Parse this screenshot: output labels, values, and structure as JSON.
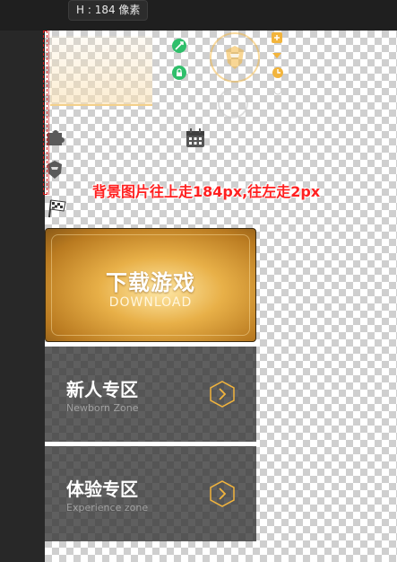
{
  "tooltip": {
    "text": "H : 184 像素"
  },
  "annotation": "背景图片往上走184px,往左走2px",
  "download": {
    "title": "下载游戏",
    "subtitle": "DOWNLOAD"
  },
  "zones": [
    {
      "title": "新人专区",
      "subtitle": "Newborn Zone"
    },
    {
      "title": "体验专区",
      "subtitle": "Experience zone"
    }
  ],
  "colors": {
    "annotation": "#ff2020",
    "gold": "#e8b048",
    "zone_bg": "#323232",
    "arrow": "#f2b43c",
    "green": "#2fbf6b"
  },
  "icons": [
    "sword-icon",
    "lock-icon",
    "helmet-icon",
    "clock-icon",
    "puzzle-icon",
    "calendar-icon",
    "flag-icon",
    "chevron-right-icon"
  ]
}
